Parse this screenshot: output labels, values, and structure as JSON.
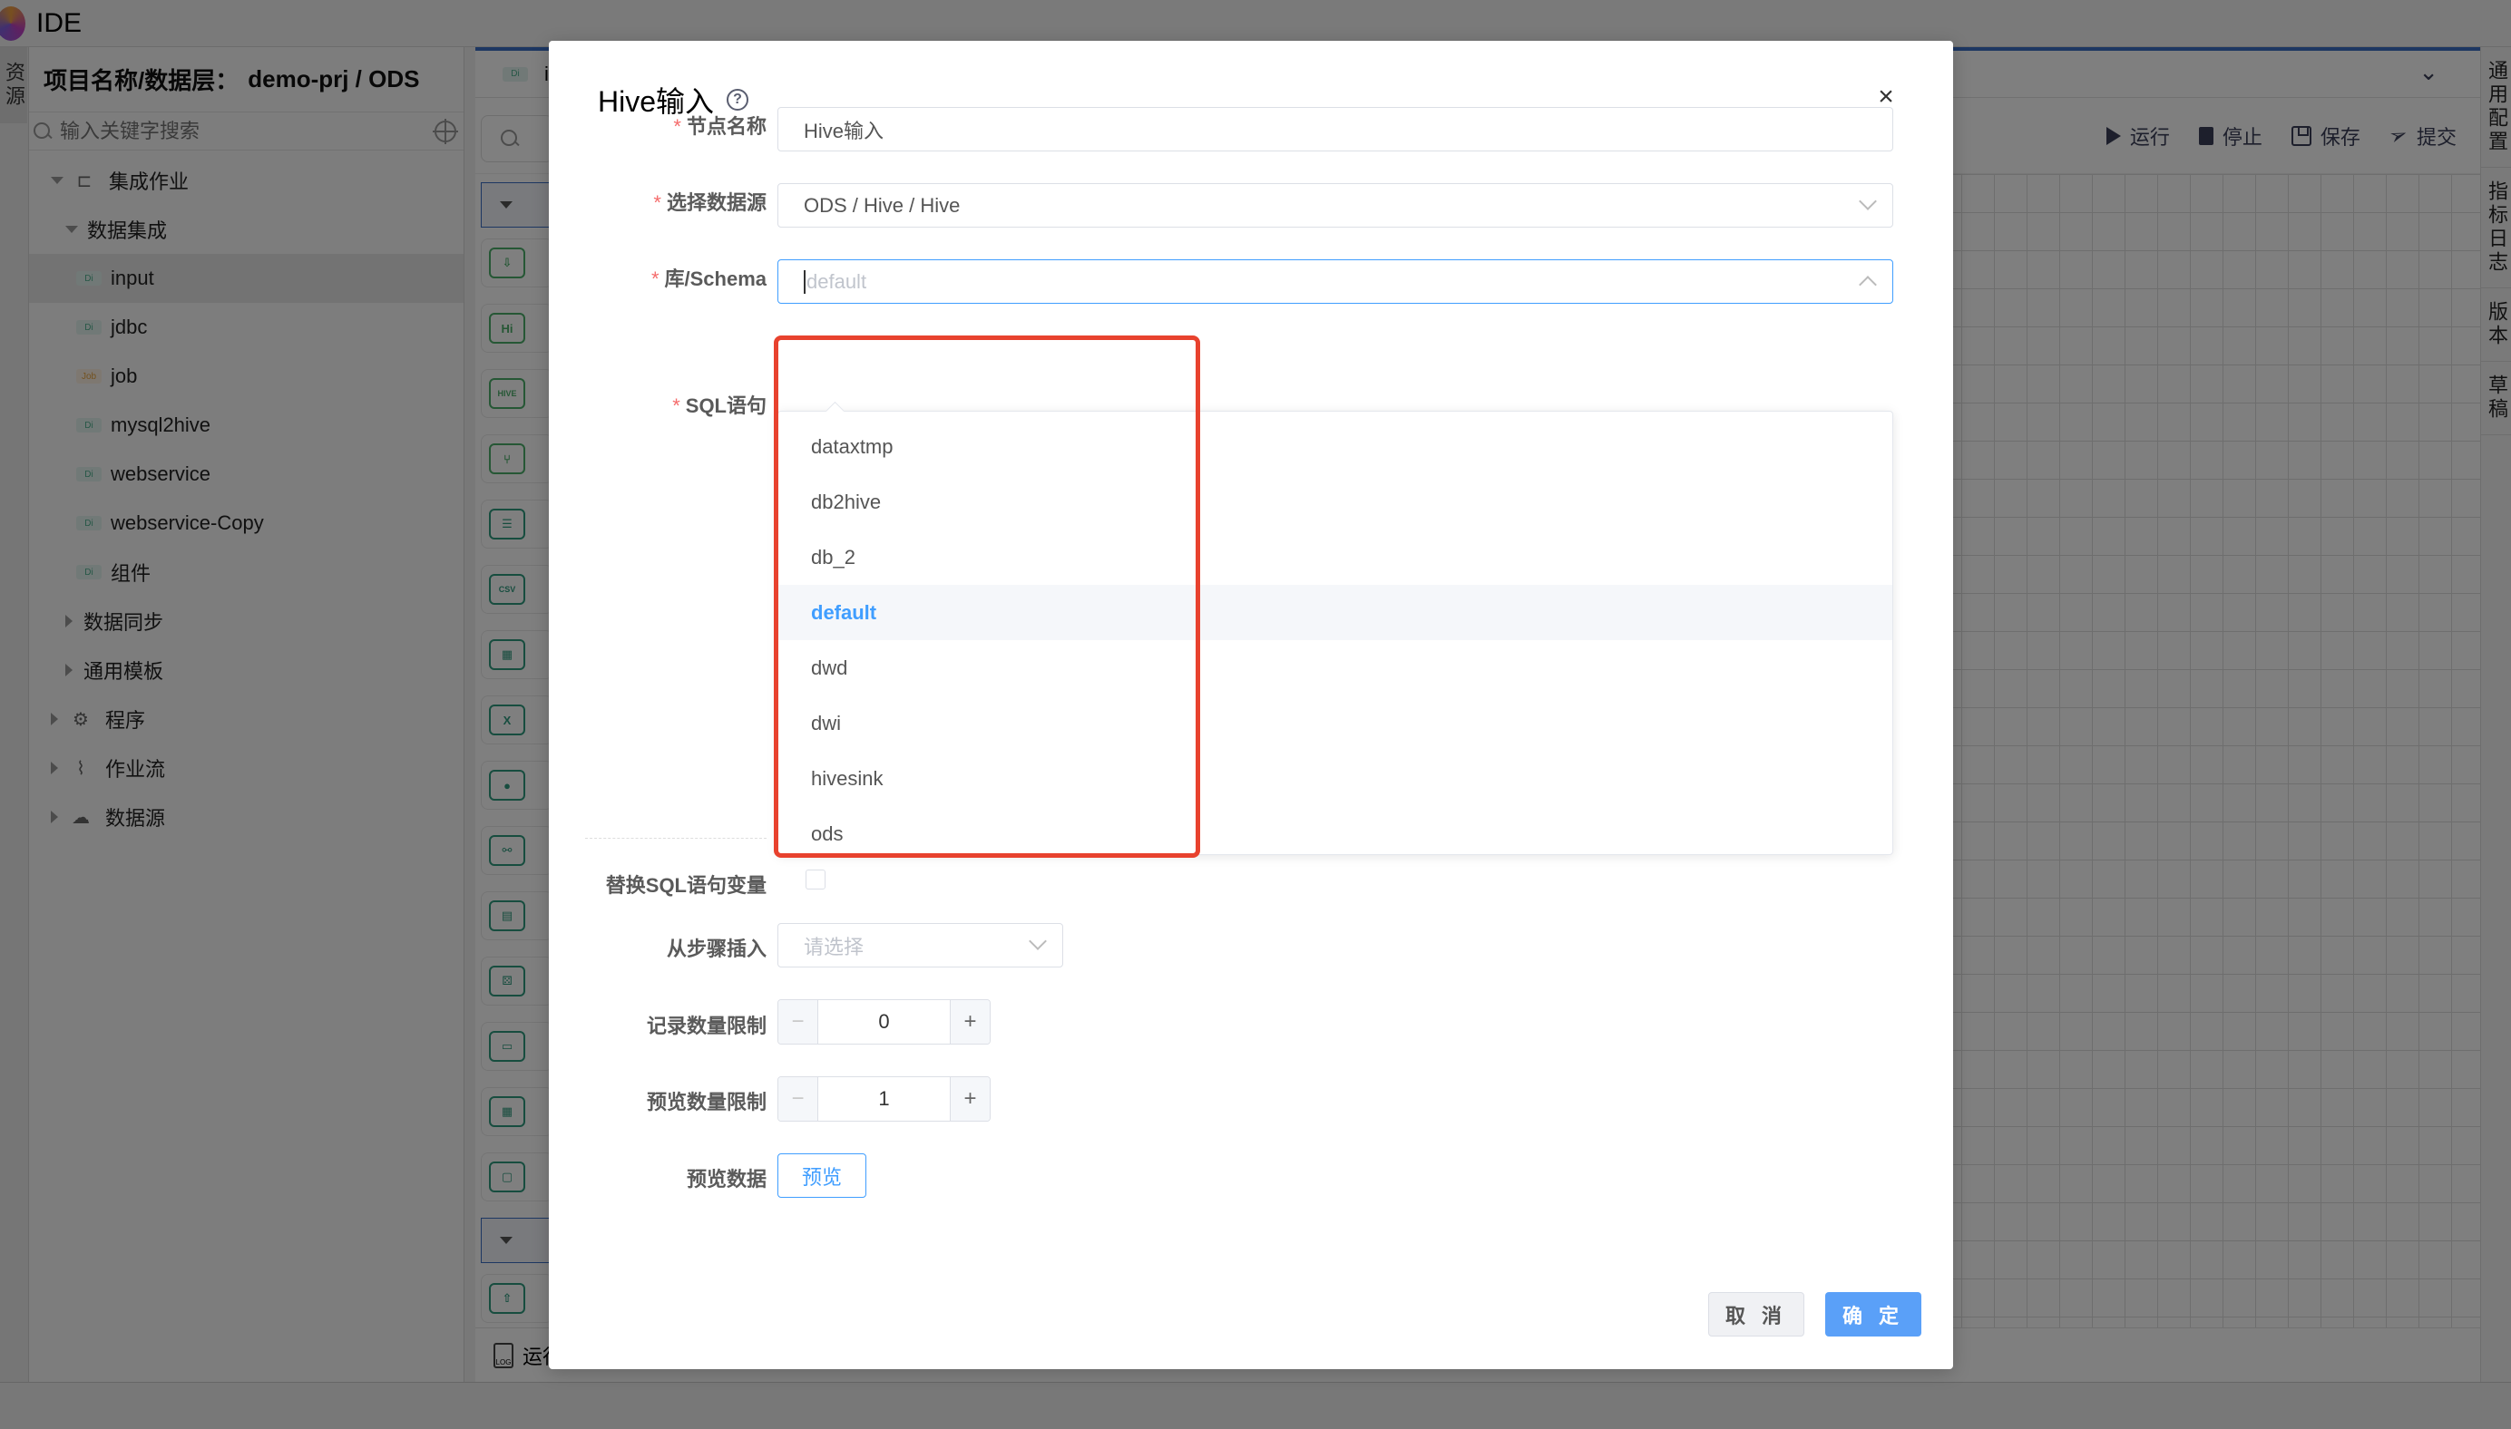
{
  "app": {
    "title": "IDE"
  },
  "left_tabs": [
    "资源"
  ],
  "sidebar": {
    "header_label": "项目名称/数据层：",
    "header_value": "demo-prj / ODS",
    "search_placeholder": "输入关键字搜索",
    "tree": [
      {
        "label": "集成作业",
        "level": 0,
        "state": "expanded",
        "icon": "workflow-tree-icon"
      },
      {
        "label": "数据集成",
        "level": 1,
        "state": "expanded"
      },
      {
        "label": "input",
        "level": 2,
        "badge": "Di",
        "selected": true
      },
      {
        "label": "jdbc",
        "level": 2,
        "badge": "Di"
      },
      {
        "label": "job",
        "level": 2,
        "badge": "Job"
      },
      {
        "label": "mysql2hive",
        "level": 2,
        "badge": "Di"
      },
      {
        "label": "webservice",
        "level": 2,
        "badge": "Di"
      },
      {
        "label": "webservice-Copy",
        "level": 2,
        "badge": "Di"
      },
      {
        "label": "组件",
        "level": 2,
        "badge": "Di"
      },
      {
        "label": "数据同步",
        "level": 1,
        "state": "collapsed"
      },
      {
        "label": "通用模板",
        "level": 1,
        "state": "collapsed"
      },
      {
        "label": "程序",
        "level": 0,
        "state": "collapsed",
        "icon": "gear-icon"
      },
      {
        "label": "作业流",
        "level": 0,
        "state": "collapsed",
        "icon": "flow-icon"
      },
      {
        "label": "数据源",
        "level": 0,
        "state": "collapsed",
        "icon": "datasource-icon"
      }
    ]
  },
  "editor": {
    "tab": {
      "badge": "Di",
      "label": "input"
    },
    "toolbar": {
      "run": "运行",
      "stop": "停止",
      "save": "保存",
      "submit": "提交"
    },
    "component_icons": [
      "Import",
      "Hi",
      "HIVE",
      "JIL",
      "Doc",
      "CSV",
      "Table",
      "X",
      "O",
      "Graph",
      "List",
      "Dice",
      "Monitor",
      "TableIn",
      "FolderIn"
    ],
    "log_label": "运行日志"
  },
  "right_tabs": [
    "通用配置",
    "指标日志",
    "版本",
    "草稿"
  ],
  "modal": {
    "title": "Hive输入",
    "fields": {
      "node_name": {
        "label": "节点名称",
        "required": true,
        "value": "Hive输入"
      },
      "datasource": {
        "label": "选择数据源",
        "required": true,
        "value": "ODS / Hive / Hive"
      },
      "schema": {
        "label": "库/Schema",
        "required": true,
        "placeholder": "default"
      },
      "sql": {
        "label": "SQL语句",
        "required": true
      },
      "replace_vars": {
        "label": "替换SQL语句变量",
        "checked": false
      },
      "insert_from_step": {
        "label": "从步骤插入",
        "placeholder": "请选择"
      },
      "record_limit": {
        "label": "记录数量限制",
        "value": "0"
      },
      "preview_limit": {
        "label": "预览数量限制",
        "value": "1"
      },
      "preview_data": {
        "label": "预览数据",
        "button": "预览"
      }
    },
    "schema_options": [
      "dataxtmp",
      "db2hive",
      "db_2",
      "default",
      "dwd",
      "dwi",
      "hivesink",
      "ods"
    ],
    "schema_selected": "default",
    "cancel": "取 消",
    "confirm": "确 定"
  },
  "colors": {
    "primary": "#409eff",
    "confirm_bg": "#5aa0f8",
    "highlight": "#e8422e",
    "required": "#f56c6c"
  }
}
